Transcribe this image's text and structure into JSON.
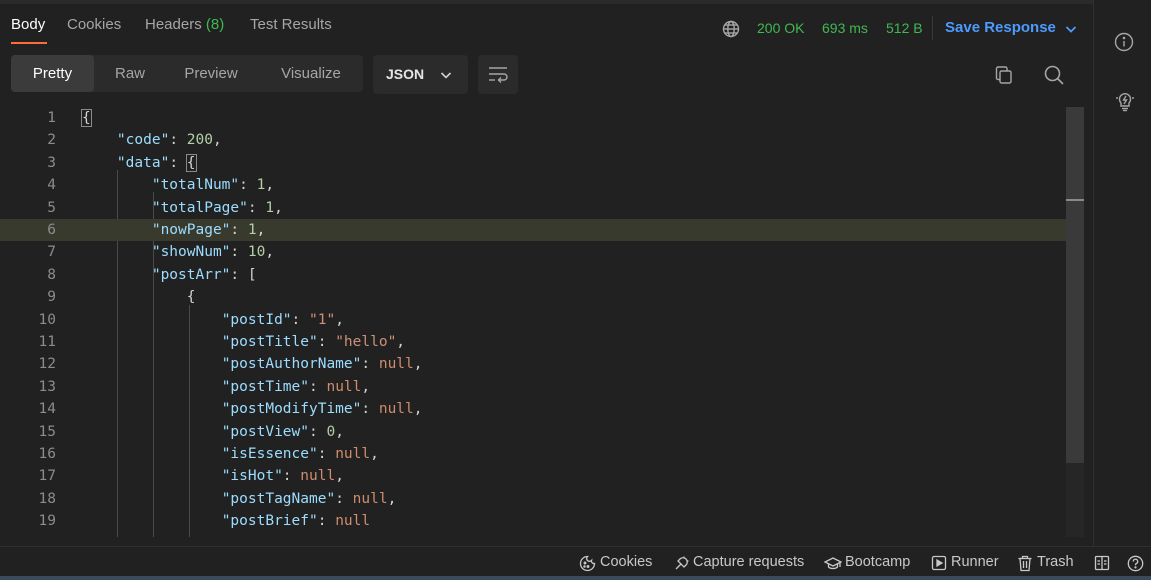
{
  "tabs": [
    {
      "label": "Body"
    },
    {
      "label": "Cookies"
    },
    {
      "label": "Headers",
      "count": "(8)"
    },
    {
      "label": "Test Results"
    }
  ],
  "response_meta": {
    "status": "200 OK",
    "time": "693 ms",
    "size": "512 B",
    "save_label": "Save Response"
  },
  "view_modes": [
    "Pretty",
    "Raw",
    "Preview",
    "Visualize"
  ],
  "format": "JSON",
  "code_lines": [
    {
      "num": "1"
    },
    {
      "num": "2"
    },
    {
      "num": "3"
    },
    {
      "num": "4"
    },
    {
      "num": "5"
    },
    {
      "num": "6"
    },
    {
      "num": "7"
    },
    {
      "num": "8"
    },
    {
      "num": "9"
    },
    {
      "num": "10"
    },
    {
      "num": "11"
    },
    {
      "num": "12"
    },
    {
      "num": "13"
    },
    {
      "num": "14"
    },
    {
      "num": "15"
    },
    {
      "num": "16"
    },
    {
      "num": "17"
    },
    {
      "num": "18"
    },
    {
      "num": "19"
    }
  ],
  "json": {
    "code_key": "\"code\"",
    "code_val": "200",
    "data_key": "\"data\"",
    "totalNum_key": "\"totalNum\"",
    "totalNum_val": "1",
    "totalPage_key": "\"totalPage\"",
    "totalPage_val": "1",
    "nowPage_key": "\"nowPage\"",
    "nowPage_val": "1",
    "showNum_key": "\"showNum\"",
    "showNum_val": "10",
    "postArr_key": "\"postArr\"",
    "postId_key": "\"postId\"",
    "postId_val": "\"1\"",
    "postTitle_key": "\"postTitle\"",
    "postTitle_val": "\"hello\"",
    "postAuthorName_key": "\"postAuthorName\"",
    "postAuthorName_val": "null",
    "postTime_key": "\"postTime\"",
    "postTime_val": "null",
    "postModifyTime_key": "\"postModifyTime\"",
    "postModifyTime_val": "null",
    "postView_key": "\"postView\"",
    "postView_val": "0",
    "isEssence_key": "\"isEssence\"",
    "isEssence_val": "null",
    "isHot_key": "\"isHot\"",
    "isHot_val": "null",
    "postTagName_key": "\"postTagName\"",
    "postTagName_val": "null",
    "postBrief_key": "\"postBrief\"",
    "postBrief_val": "null"
  },
  "statusbar": {
    "cookies": "Cookies",
    "capture": "Capture requests",
    "bootcamp": "Bootcamp",
    "runner": "Runner",
    "trash": "Trash"
  },
  "colors": {
    "accent": "#ff6c37",
    "success": "#3fb950",
    "link": "#4c9bff",
    "json_key": "#9cdcfe",
    "json_string": "#ce9178",
    "json_number": "#b5cea8"
  },
  "icons": [
    "globe-icon",
    "chevron-down-icon",
    "wrap-lines-icon",
    "copy-icon",
    "search-icon",
    "info-icon",
    "lightbulb-icon",
    "cookie-icon",
    "capture-icon",
    "bootcamp-icon",
    "runner-icon",
    "trash-icon",
    "two-pane-icon",
    "help-icon"
  ]
}
